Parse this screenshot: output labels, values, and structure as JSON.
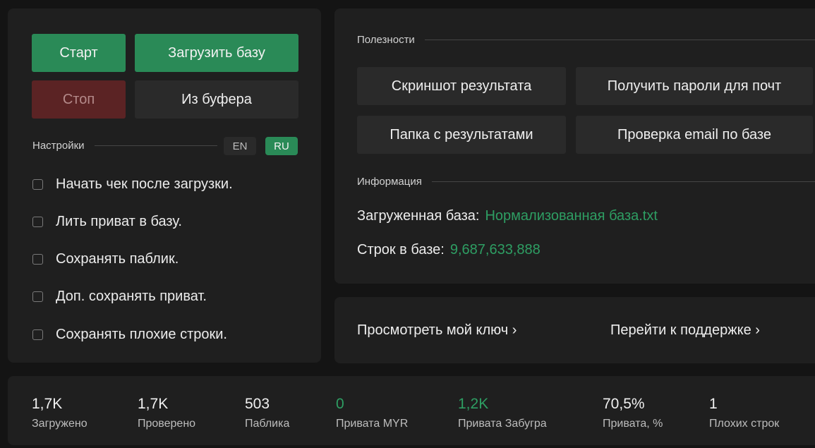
{
  "left": {
    "buttons": {
      "start": "Старт",
      "load_base": "Загрузить базу",
      "stop": "Стоп",
      "from_buffer": "Из буфера"
    },
    "settings_label": "Настройки",
    "lang": {
      "en": "EN",
      "ru": "RU",
      "selected": "RU"
    },
    "options": [
      {
        "label": "Начать чек после загрузки.",
        "checked": false
      },
      {
        "label": "Лить приват в базу.",
        "checked": false
      },
      {
        "label": "Сохранять паблик.",
        "checked": false
      },
      {
        "label": "Доп. сохранять приват.",
        "checked": false
      },
      {
        "label": "Сохранять плохие строки.",
        "checked": false
      }
    ]
  },
  "utilities": {
    "title": "Полезности",
    "buttons": {
      "screenshot": "Скриншот результата",
      "get_passwords": "Получить пароли для почт",
      "results_folder": "Папка с результатами",
      "check_email": "Проверка email по базе"
    }
  },
  "information": {
    "title": "Информация",
    "loaded_base_label": "Загруженная база:",
    "loaded_base_value": "Нормализованная база.txt",
    "rows_label": "Строк в базе:",
    "rows_value": "9,687,633,888"
  },
  "links": {
    "view_key": "Просмотреть мой ключ ›",
    "support": "Перейти к поддержке ›"
  },
  "stats": [
    {
      "value": "1,7K",
      "label": "Загружено"
    },
    {
      "value": "1,7K",
      "label": "Проверено"
    },
    {
      "value": "503",
      "label": "Паблика"
    },
    {
      "value": "0",
      "label": "Привата MYR"
    },
    {
      "value": "1,2K",
      "label": "Привата Забугра"
    },
    {
      "value": "70,5%",
      "label": "Привата, %"
    },
    {
      "value": "1",
      "label": "Плохих строк"
    }
  ],
  "colors": {
    "accent_green": "#2a8a57",
    "value_green": "#2e9e63",
    "stop_red": "#5b2324",
    "panel_bg": "#1f1f1f",
    "page_bg": "#141414"
  }
}
